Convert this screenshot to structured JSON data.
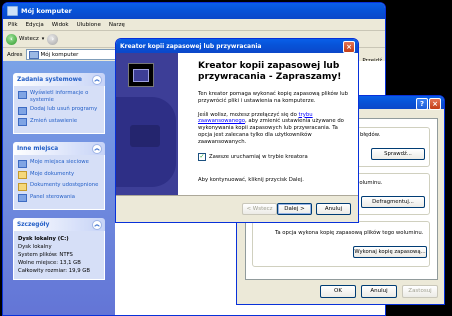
{
  "explorer": {
    "title": "Mój komputer",
    "menu": [
      "Plik",
      "Edycja",
      "Widok",
      "Ulubione",
      "Narzę"
    ],
    "back_label": "Wstecz",
    "address_label": "Adres",
    "address_value": "Mój komputer",
    "go_label": "Przejdź",
    "panels": {
      "system_tasks": {
        "title": "Zadania systemowe",
        "items": [
          "Wyświetl informacje o systemie",
          "Dodaj lub usuń programy",
          "Zmień ustawienie"
        ]
      },
      "other_places": {
        "title": "Inne miejsca",
        "items": [
          "Moje miejsca sieciowe",
          "Moje dokumenty",
          "Dokumenty udostępnione",
          "Panel sterowania"
        ]
      },
      "details": {
        "title": "Szczegóły",
        "name": "Dysk lokalny (C:)",
        "type": "Dysk lokalny",
        "filesystem": "System plików: NTFS",
        "free": "Wolne miejsce: 13,1 GB",
        "total": "Całkowity rozmiar: 19,9 GB"
      }
    }
  },
  "properties": {
    "error_text": "u błędów.",
    "check_button": "Sprawdź...",
    "defrag_text": "woluminu.",
    "defrag_button": "Defragmentuj...",
    "backup_text": "Ta opcja wykona kopię zapasową plików tego woluminu.",
    "backup_button": "Wykonaj kopię zapasową...",
    "ok": "OK",
    "cancel": "Anuluj",
    "apply": "Zastosuj"
  },
  "wizard": {
    "title": "Kreator kopii zapasowej lub przywracania",
    "heading": "Kreator kopii zapasowej lub przywracania - Zapraszamy!",
    "intro": "Ten kreator pomaga wykonać kopię zapasową plików lub przywrócić pliki i ustawienia na komputerze.",
    "adv_pre": "Jeśli wolisz, możesz przełączyć się do ",
    "adv_link": "trybu zaawansowanego",
    "adv_post": ", aby zmienić ustawienia używane do wykonywania kopii zapasowych lub przywracania. Ta opcja jest zalecana tylko dla użytkowników zaawansowanych.",
    "checkbox_label": "Zawsze uruchamiaj w trybie kreatora",
    "continue_text": "Aby kontynuować, kliknij przycisk Dalej.",
    "back_button": "< Wstecz",
    "next_button": "Dalej >",
    "cancel_button": "Anuluj"
  }
}
